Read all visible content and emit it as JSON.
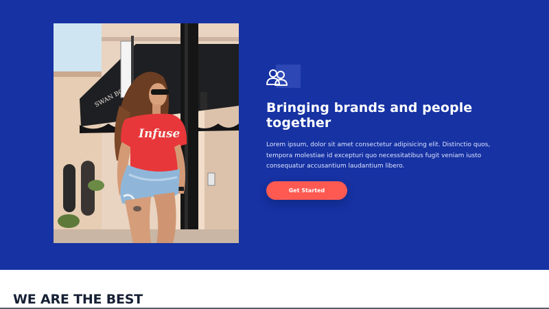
{
  "hero": {
    "background_color": "#1632a3",
    "icon": "people-icon",
    "heading": "Bringing brands and people together",
    "description": "Lorem ipsum, dolor sit amet consectetur adipisicing elit. Distinctio quos, tempora molestiae id excepturi quo necessitatibus fugit veniam iusto consequatur accusantium laudantium libero.",
    "cta_label": "Get Started",
    "cta_color": "#ff5a52",
    "photo_shirt_text": "Infuse",
    "photo_sign_text": "SWAN BOUTIQUE"
  },
  "section": {
    "title": "WE ARE THE BEST"
  }
}
